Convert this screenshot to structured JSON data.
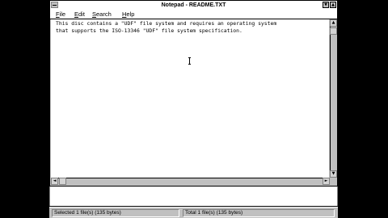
{
  "window": {
    "title": "Notepad - README.TXT",
    "minimize_glyph": "▼",
    "maximize_glyph": "▲"
  },
  "menu": {
    "items": [
      {
        "label": "File"
      },
      {
        "label": "Edit"
      },
      {
        "label": "Search"
      },
      {
        "label": "Help"
      }
    ]
  },
  "document": {
    "lines": [
      "This disc contains a \"UDF\" file system and requires an operating system",
      "that supports the ISO-13346 \"UDF\" file system specification."
    ]
  },
  "scrollbars": {
    "up_glyph": "▲",
    "down_glyph": "▼",
    "left_glyph": "◄",
    "right_glyph": "►"
  },
  "status": {
    "left": "Selected 1 file(s) (135 bytes)",
    "right": "Total 1 file(s) (135 bytes)"
  }
}
